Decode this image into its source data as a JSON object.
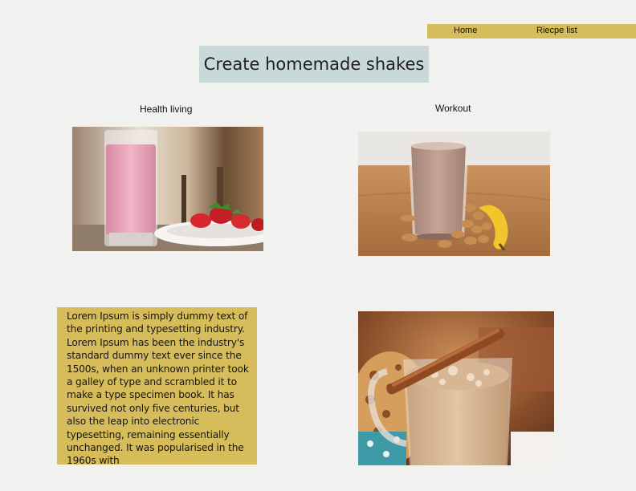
{
  "nav": {
    "home_label": "Home",
    "recipes_label": "Riecpe list",
    "bg_color": "#d6bc5a"
  },
  "header": {
    "title": "Create homemade shakes"
  },
  "sections": {
    "health_label": "Health living",
    "workout_label": "Workout"
  },
  "body_text": "Lorem Ipsum is simply dummy text of the printing and typesetting industry. Lorem Ipsum has been the industry's standard dummy text ever since the 1500s, when an unknown printer took a galley of type and scrambled it to make a type specimen book. It has survived not only five centuries, but also the leap into electronic typesetting, remaining essentially unchanged. It was popularised in the 1960s with",
  "colors": {
    "accent": "#d6bc5a",
    "title_bg": "#c9d8d9",
    "page_bg": "#f1f1ef"
  }
}
